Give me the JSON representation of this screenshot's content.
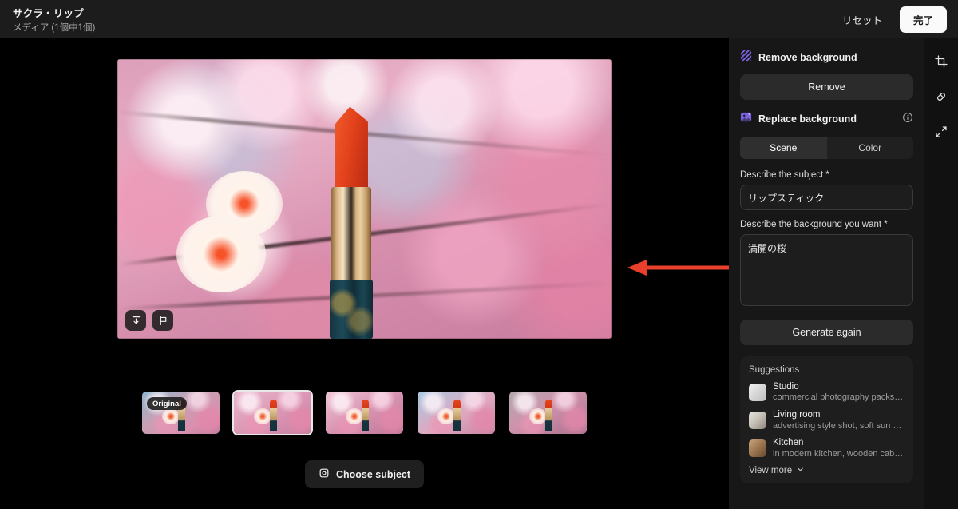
{
  "topbar": {
    "title": "サクラ・リップ",
    "subtitle": "メディア (1個中1個)",
    "reset_label": "リセット",
    "done_label": "完了"
  },
  "canvas": {
    "image_alt": "満開の桜を背景にしたオレンジ色のリップスティック",
    "download_icon": "download-icon",
    "flag_icon": "flag-icon",
    "choose_subject_label": "Choose subject",
    "choose_subject_icon": "subject-target-icon",
    "annotation": {
      "type": "arrow",
      "color": "#e8402a",
      "direction": "left",
      "points_from": "background-prompt-textarea",
      "points_to": "hero-image"
    }
  },
  "thumbnails": [
    {
      "label": "Original",
      "badge": "Original",
      "selected": false,
      "style": "t-sky"
    },
    {
      "label": "Variation 1",
      "badge": "",
      "selected": true,
      "style": "t-pink"
    },
    {
      "label": "Variation 2",
      "badge": "",
      "selected": false,
      "style": "t-pink2"
    },
    {
      "label": "Variation 3",
      "badge": "",
      "selected": false,
      "style": "t-blue"
    },
    {
      "label": "Variation 4",
      "badge": "",
      "selected": false,
      "style": "t-dark"
    }
  ],
  "panel": {
    "remove_background": {
      "icon": "stripes-icon",
      "title": "Remove background",
      "button_label": "Remove"
    },
    "replace_background": {
      "icon": "image-sparkle-icon",
      "title": "Replace background",
      "info_icon": "info-icon",
      "tabs": [
        {
          "label": "Scene",
          "active": true
        },
        {
          "label": "Color",
          "active": false
        }
      ],
      "subject_label": "Describe the subject *",
      "subject_value": "リップスティック",
      "subject_placeholder": "Describe the subject",
      "background_label": "Describe the background you want *",
      "background_value": "満開の桜",
      "background_placeholder": "Describe the background you want",
      "generate_label": "Generate again"
    },
    "suggestions": {
      "title": "Suggestions",
      "items": [
        {
          "name": "Studio",
          "desc": "commercial photography packsh…",
          "thumb": "st-studio"
        },
        {
          "name": "Living room",
          "desc": "advertising style shot, soft sun s…",
          "thumb": "st-living"
        },
        {
          "name": "Kitchen",
          "desc": "in modern kitchen, wooden cabi…",
          "thumb": "st-kitchen"
        }
      ],
      "view_more_label": "View more",
      "view_more_icon": "chevron-down-icon"
    }
  },
  "rail": {
    "items": [
      {
        "icon": "crop-icon",
        "name": "crop-tool"
      },
      {
        "icon": "eraser-icon",
        "name": "eraser-tool"
      },
      {
        "icon": "resize-diagonal-icon",
        "name": "resize-tool"
      }
    ]
  },
  "colors": {
    "accent_purple": "#7b61e0",
    "annotation_red": "#e8402a",
    "panel_bg": "#171717",
    "topbar_bg": "#1c1c1c"
  }
}
